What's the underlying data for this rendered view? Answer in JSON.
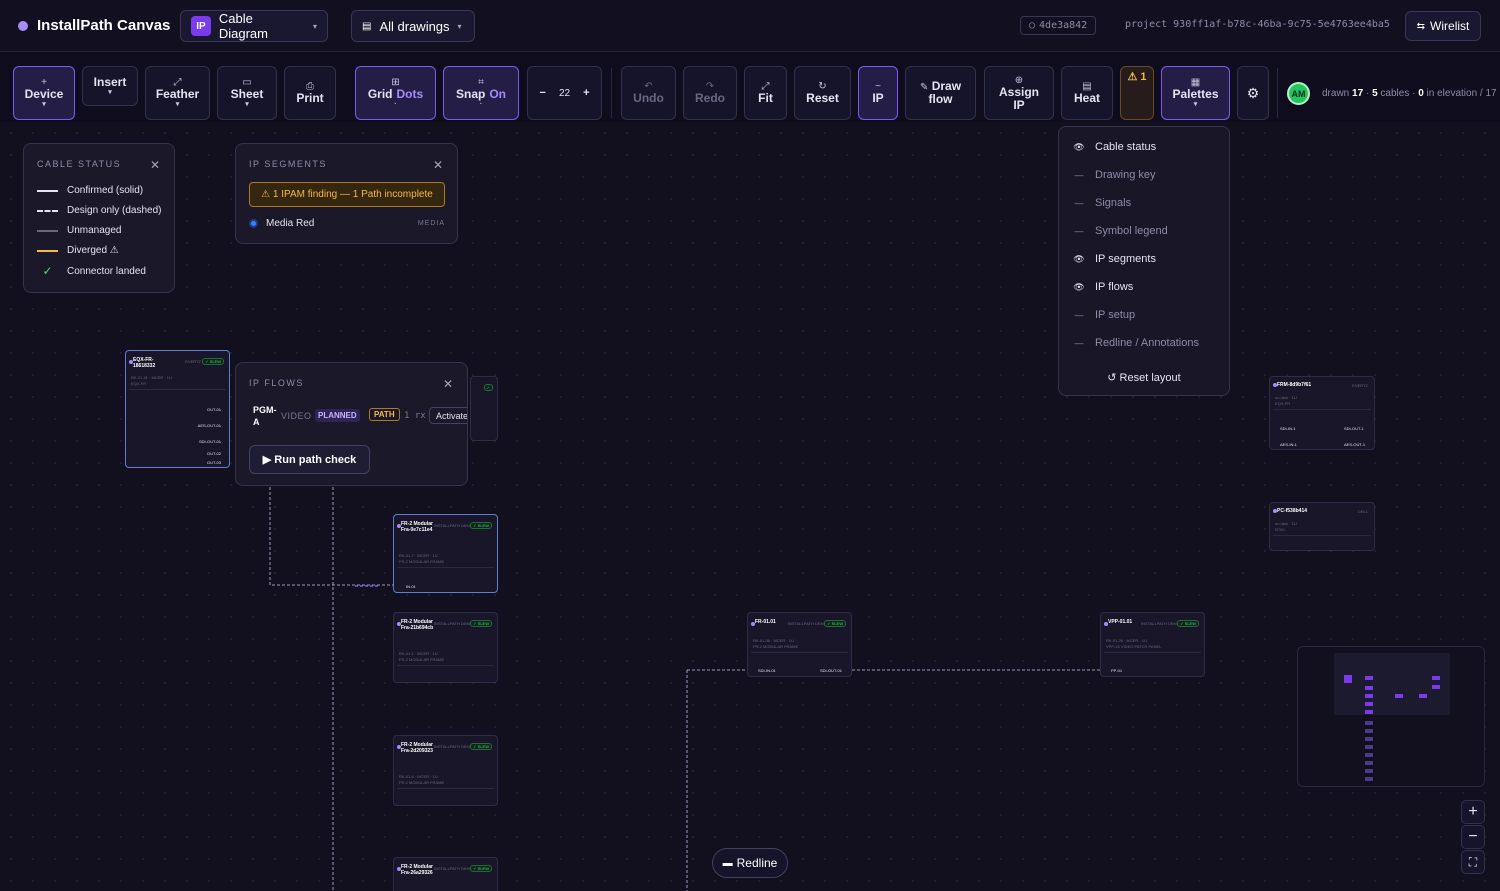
{
  "header": {
    "app_title": "InstallPath Canvas",
    "diagram_badge": "IP",
    "diagram_name": "Cable Diagram",
    "drawings_filter": "All drawings",
    "commit_hash": "4de3a842",
    "project_label": "project 930ff1af-b78c-46ba-9c75-5e4763ee4ba5",
    "wirelist_label": "Wirelist"
  },
  "toolbar": {
    "device": "Device",
    "insert": "Insert",
    "feather": "Feather",
    "sheet": "Sheet",
    "print": "Print",
    "grid": "Grid",
    "grid_mode": "Dots",
    "snap": "Snap",
    "snap_state": "On",
    "zoom_minus": "−",
    "zoom_value": "22",
    "zoom_plus": "+",
    "undo": "Undo",
    "redo": "Redo",
    "fit": "Fit",
    "reset": "Reset",
    "ip": "IP",
    "draw_flow_1": "Draw",
    "draw_flow_2": "flow",
    "assign_ip_1": "Assign",
    "assign_ip_2": "IP",
    "heat": "Heat",
    "warnings": "⚠ 1",
    "palettes": "Palettes"
  },
  "user": {
    "initials": "AM"
  },
  "stats": {
    "drawn_label": "drawn",
    "drawn": "17",
    "sep": "·",
    "cables": "5",
    "cables_label": "cables ·",
    "elevation": "0",
    "elevation_label": "in elevation / 17"
  },
  "cable_status": {
    "title": "CABLE STATUS",
    "items": [
      "Confirmed (solid)",
      "Design only (dashed)",
      "Unmanaged",
      "Diverged ⚠",
      "Connector landed"
    ]
  },
  "ip_segments": {
    "title": "IP SEGMENTS",
    "warning": "⚠ 1 IPAM finding — 1 Path incomplete",
    "segment_name": "Media Red",
    "segment_tag": "MEDIA"
  },
  "ip_flows": {
    "title": "IP FLOWS",
    "flow_name_1": "PGM-",
    "flow_name_2": "A",
    "flow_type": "VIDEO",
    "flow_state": "PLANNED",
    "flow_path": "PATH",
    "flow_rx": "1 rx",
    "activate": "Activate",
    "run_check": "▶ Run path check"
  },
  "palettes_menu": {
    "items": [
      {
        "label": "Cable status",
        "visible": true
      },
      {
        "label": "Drawing key",
        "visible": false
      },
      {
        "label": "Signals",
        "visible": false
      },
      {
        "label": "Symbol legend",
        "visible": false
      },
      {
        "label": "IP segments",
        "visible": true
      },
      {
        "label": "IP flows",
        "visible": true
      },
      {
        "label": "IP setup",
        "visible": false
      },
      {
        "label": "Redline / Annotations",
        "visible": false
      }
    ],
    "reset": "↺ Reset layout"
  },
  "nodes": [
    {
      "title": "EQX-FR-18618332",
      "vendor": "EVERTZ",
      "status": "✓ SLEW",
      "sub1": "RK-01.41 · MCER · 1U",
      "sub2": "EQX-FR",
      "ports": [
        "OUT-01",
        "AES-OUT-01",
        "SDI-OUT-01",
        "OUT-02",
        "OUT-03"
      ]
    },
    {
      "title": "FR-2 Modular Fra-0e7c11e4",
      "vendor": "INSTALLPATH DEMO",
      "status": "✓ SLEW",
      "sub1": "RK-01.7 · MCER · 1U",
      "sub2": "FR-2 MODULAR FRAME",
      "port": "IN-01"
    },
    {
      "title": "FR-2 Modular Fra-21b694cb",
      "vendor": "INSTALLPATH DEMO",
      "status": "✓ SLEW",
      "sub1": "RK-01.1 · MCER · 1U",
      "sub2": "FR-2 MODULAR FRAME"
    },
    {
      "title": "FR-2 Modular Fra-2d209323",
      "vendor": "INSTALLPATH DEMO",
      "status": "✓ SLEW",
      "sub1": "RK-01.6 · MCER · 1U",
      "sub2": "FR-2 MODULAR FRAME"
    },
    {
      "title": "FR-2 Modular Fra-26a29326",
      "vendor": "INSTALLPATH DEMO",
      "status": "✓ SLEW"
    },
    {
      "title": "FR-01.01",
      "vendor": "INSTALLPATH DEMO",
      "status": "✓ SLEW",
      "sub1": "RK-01.36 · MCER · 1U",
      "sub2": "FR-2 MODULAR FRAME",
      "port_in": "SDI-IN-01",
      "port_out": "SDI-OUT-01"
    },
    {
      "title": "VPP-01.01",
      "vendor": "INSTALLPATH DEMO",
      "status": "✓ SLEW",
      "sub1": "RK-01.26 · MCER · 1U",
      "sub2": "VPP-24 VIDEO PATCH PANEL",
      "port": "PP-01"
    },
    {
      "title": "FRM-8d9b7f61",
      "vendor": "EVERTZ",
      "sub1": "no rack · 1U",
      "sub2": "EQX-FR",
      "ports": [
        "SDI-IN-1",
        "SDI-OUT-1",
        "AES-IN-1",
        "AES-OUT-1"
      ]
    },
    {
      "title": "PC-f538b414",
      "vendor": "DELL",
      "sub1": "no rack · 1U",
      "sub2": "R760"
    }
  ],
  "redline_label": "Redline",
  "colors": {
    "accent": "#7c3aed",
    "confirmed": "#e5e2f2",
    "diverged": "#f5b84a",
    "landed": "#4ade80",
    "segment": "#3b82f6"
  },
  "icons": [
    "plus-icon",
    "expand-icon",
    "sheet-icon",
    "print-icon",
    "grid-icon",
    "snap-icon",
    "undo-icon",
    "redo-icon",
    "fit-icon",
    "reset-icon",
    "pencil-icon",
    "globe-icon",
    "heat-icon",
    "warning-icon",
    "palette-icon",
    "gear-icon",
    "eye-icon",
    "swap-icon"
  ]
}
